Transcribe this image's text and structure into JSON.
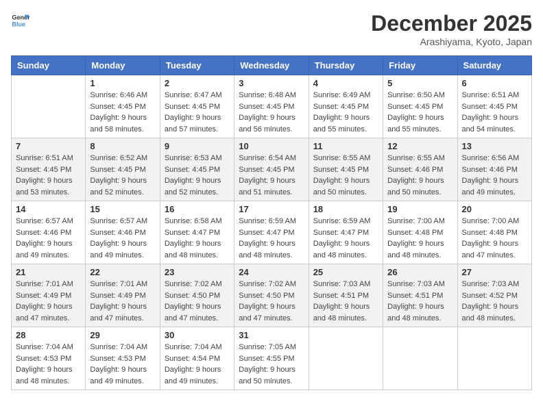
{
  "header": {
    "logo_line1": "General",
    "logo_line2": "Blue",
    "month": "December 2025",
    "location": "Arashiyama, Kyoto, Japan"
  },
  "days_of_week": [
    "Sunday",
    "Monday",
    "Tuesday",
    "Wednesday",
    "Thursday",
    "Friday",
    "Saturday"
  ],
  "weeks": [
    [
      {
        "day": "",
        "sunrise": "",
        "sunset": "",
        "daylight": ""
      },
      {
        "day": "1",
        "sunrise": "Sunrise: 6:46 AM",
        "sunset": "Sunset: 4:45 PM",
        "daylight": "Daylight: 9 hours and 58 minutes."
      },
      {
        "day": "2",
        "sunrise": "Sunrise: 6:47 AM",
        "sunset": "Sunset: 4:45 PM",
        "daylight": "Daylight: 9 hours and 57 minutes."
      },
      {
        "day": "3",
        "sunrise": "Sunrise: 6:48 AM",
        "sunset": "Sunset: 4:45 PM",
        "daylight": "Daylight: 9 hours and 56 minutes."
      },
      {
        "day": "4",
        "sunrise": "Sunrise: 6:49 AM",
        "sunset": "Sunset: 4:45 PM",
        "daylight": "Daylight: 9 hours and 55 minutes."
      },
      {
        "day": "5",
        "sunrise": "Sunrise: 6:50 AM",
        "sunset": "Sunset: 4:45 PM",
        "daylight": "Daylight: 9 hours and 55 minutes."
      },
      {
        "day": "6",
        "sunrise": "Sunrise: 6:51 AM",
        "sunset": "Sunset: 4:45 PM",
        "daylight": "Daylight: 9 hours and 54 minutes."
      }
    ],
    [
      {
        "day": "7",
        "sunrise": "Sunrise: 6:51 AM",
        "sunset": "Sunset: 4:45 PM",
        "daylight": "Daylight: 9 hours and 53 minutes."
      },
      {
        "day": "8",
        "sunrise": "Sunrise: 6:52 AM",
        "sunset": "Sunset: 4:45 PM",
        "daylight": "Daylight: 9 hours and 52 minutes."
      },
      {
        "day": "9",
        "sunrise": "Sunrise: 6:53 AM",
        "sunset": "Sunset: 4:45 PM",
        "daylight": "Daylight: 9 hours and 52 minutes."
      },
      {
        "day": "10",
        "sunrise": "Sunrise: 6:54 AM",
        "sunset": "Sunset: 4:45 PM",
        "daylight": "Daylight: 9 hours and 51 minutes."
      },
      {
        "day": "11",
        "sunrise": "Sunrise: 6:55 AM",
        "sunset": "Sunset: 4:45 PM",
        "daylight": "Daylight: 9 hours and 50 minutes."
      },
      {
        "day": "12",
        "sunrise": "Sunrise: 6:55 AM",
        "sunset": "Sunset: 4:46 PM",
        "daylight": "Daylight: 9 hours and 50 minutes."
      },
      {
        "day": "13",
        "sunrise": "Sunrise: 6:56 AM",
        "sunset": "Sunset: 4:46 PM",
        "daylight": "Daylight: 9 hours and 49 minutes."
      }
    ],
    [
      {
        "day": "14",
        "sunrise": "Sunrise: 6:57 AM",
        "sunset": "Sunset: 4:46 PM",
        "daylight": "Daylight: 9 hours and 49 minutes."
      },
      {
        "day": "15",
        "sunrise": "Sunrise: 6:57 AM",
        "sunset": "Sunset: 4:46 PM",
        "daylight": "Daylight: 9 hours and 49 minutes."
      },
      {
        "day": "16",
        "sunrise": "Sunrise: 6:58 AM",
        "sunset": "Sunset: 4:47 PM",
        "daylight": "Daylight: 9 hours and 48 minutes."
      },
      {
        "day": "17",
        "sunrise": "Sunrise: 6:59 AM",
        "sunset": "Sunset: 4:47 PM",
        "daylight": "Daylight: 9 hours and 48 minutes."
      },
      {
        "day": "18",
        "sunrise": "Sunrise: 6:59 AM",
        "sunset": "Sunset: 4:47 PM",
        "daylight": "Daylight: 9 hours and 48 minutes."
      },
      {
        "day": "19",
        "sunrise": "Sunrise: 7:00 AM",
        "sunset": "Sunset: 4:48 PM",
        "daylight": "Daylight: 9 hours and 48 minutes."
      },
      {
        "day": "20",
        "sunrise": "Sunrise: 7:00 AM",
        "sunset": "Sunset: 4:48 PM",
        "daylight": "Daylight: 9 hours and 47 minutes."
      }
    ],
    [
      {
        "day": "21",
        "sunrise": "Sunrise: 7:01 AM",
        "sunset": "Sunset: 4:49 PM",
        "daylight": "Daylight: 9 hours and 47 minutes."
      },
      {
        "day": "22",
        "sunrise": "Sunrise: 7:01 AM",
        "sunset": "Sunset: 4:49 PM",
        "daylight": "Daylight: 9 hours and 47 minutes."
      },
      {
        "day": "23",
        "sunrise": "Sunrise: 7:02 AM",
        "sunset": "Sunset: 4:50 PM",
        "daylight": "Daylight: 9 hours and 47 minutes."
      },
      {
        "day": "24",
        "sunrise": "Sunrise: 7:02 AM",
        "sunset": "Sunset: 4:50 PM",
        "daylight": "Daylight: 9 hours and 47 minutes."
      },
      {
        "day": "25",
        "sunrise": "Sunrise: 7:03 AM",
        "sunset": "Sunset: 4:51 PM",
        "daylight": "Daylight: 9 hours and 48 minutes."
      },
      {
        "day": "26",
        "sunrise": "Sunrise: 7:03 AM",
        "sunset": "Sunset: 4:51 PM",
        "daylight": "Daylight: 9 hours and 48 minutes."
      },
      {
        "day": "27",
        "sunrise": "Sunrise: 7:03 AM",
        "sunset": "Sunset: 4:52 PM",
        "daylight": "Daylight: 9 hours and 48 minutes."
      }
    ],
    [
      {
        "day": "28",
        "sunrise": "Sunrise: 7:04 AM",
        "sunset": "Sunset: 4:53 PM",
        "daylight": "Daylight: 9 hours and 48 minutes."
      },
      {
        "day": "29",
        "sunrise": "Sunrise: 7:04 AM",
        "sunset": "Sunset: 4:53 PM",
        "daylight": "Daylight: 9 hours and 49 minutes."
      },
      {
        "day": "30",
        "sunrise": "Sunrise: 7:04 AM",
        "sunset": "Sunset: 4:54 PM",
        "daylight": "Daylight: 9 hours and 49 minutes."
      },
      {
        "day": "31",
        "sunrise": "Sunrise: 7:05 AM",
        "sunset": "Sunset: 4:55 PM",
        "daylight": "Daylight: 9 hours and 50 minutes."
      },
      {
        "day": "",
        "sunrise": "",
        "sunset": "",
        "daylight": ""
      },
      {
        "day": "",
        "sunrise": "",
        "sunset": "",
        "daylight": ""
      },
      {
        "day": "",
        "sunrise": "",
        "sunset": "",
        "daylight": ""
      }
    ]
  ]
}
